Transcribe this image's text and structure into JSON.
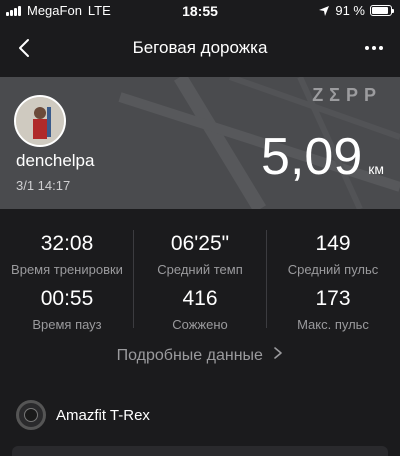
{
  "status_bar": {
    "carrier": "MegaFon",
    "network": "LTE",
    "time": "18:55",
    "battery": "91 %",
    "battery_level": 0.91,
    "icons": [
      "signal-icon",
      "location-arrow-icon",
      "battery-icon"
    ]
  },
  "header": {
    "title": "Беговая дорожка",
    "back_icon": "chevron-left-icon",
    "more_icon": "more-dots-icon"
  },
  "summary": {
    "brand": "ZΣPP",
    "user": "denchelpa",
    "date": "3/1 14:17",
    "distance": "5,09",
    "distance_unit": "км"
  },
  "stats": [
    {
      "value": "32:08",
      "label": "Время тренировки"
    },
    {
      "value": "06'25\"",
      "label": "Средний темп"
    },
    {
      "value": "149",
      "label": "Средний пульс"
    },
    {
      "value": "00:55",
      "label": "Время пауз"
    },
    {
      "value": "416",
      "label": "Сожжено"
    },
    {
      "value": "173",
      "label": "Макс. пульс"
    }
  ],
  "details_link": "Подробные данные",
  "device": {
    "name": "Amazfit T-Rex"
  },
  "colors": {
    "background": "#1b1b1d",
    "map": "#4a4b4e",
    "secondary_text": "#9a9a9d"
  }
}
